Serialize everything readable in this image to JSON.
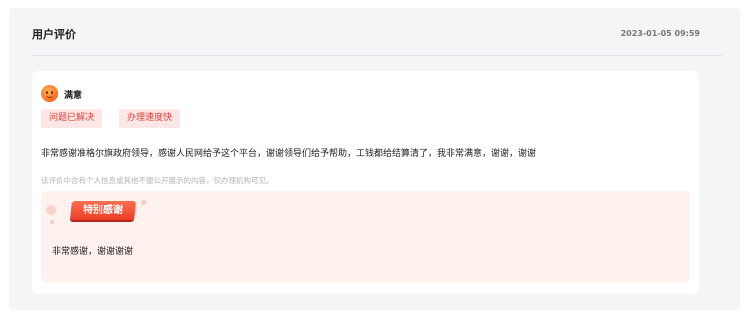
{
  "header": {
    "title": "用户评价",
    "timestamp": "2023-01-05 09:59"
  },
  "review": {
    "rating_icon": "smiley-face-icon",
    "satisfaction": "满意",
    "tags": [
      "问题已解决",
      "办理速度快"
    ],
    "content": "非常感谢准格尔旗政府领导，感谢人民网给予这个平台，谢谢领导们给予帮助，工钱都给结算清了，我非常满意，谢谢，谢谢",
    "privacy_note": "该评价中含有个人信息或其他不便公开展示的内容，仅办理机构可见。"
  },
  "special_thanks": {
    "badge": "特别感谢",
    "text": "非常感谢，谢谢谢谢"
  },
  "colors": {
    "accent": "#e0433c",
    "tag_bg": "#fde7e6",
    "thanks_bg": "#fff1ee"
  }
}
